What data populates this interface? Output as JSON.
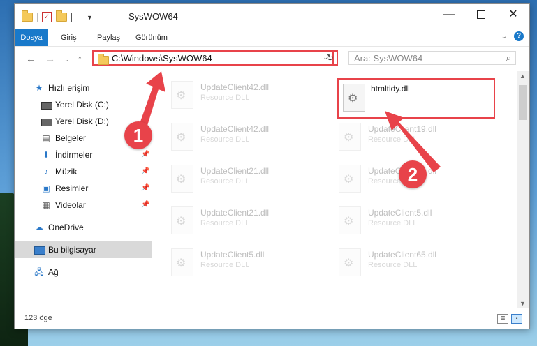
{
  "window": {
    "title": "SysWOW64"
  },
  "ribbon": {
    "tabs": [
      "Dosya",
      "Giriş",
      "Paylaş",
      "Görünüm"
    ],
    "active": "Dosya"
  },
  "address": {
    "path": "C:\\Windows\\SysWOW64"
  },
  "search": {
    "placeholder": "Ara: SysWOW64"
  },
  "sidebar": {
    "items": [
      {
        "label": "Hızlı erişim",
        "icon": "star-icon"
      },
      {
        "label": "Yerel Disk (C:)",
        "icon": "drive-icon"
      },
      {
        "label": "Yerel Disk (D:)",
        "icon": "drive-icon"
      },
      {
        "label": "Belgeler",
        "icon": "documents-icon"
      },
      {
        "label": "İndirmeler",
        "icon": "download-icon"
      },
      {
        "label": "Müzik",
        "icon": "music-icon"
      },
      {
        "label": "Resimler",
        "icon": "pictures-icon"
      },
      {
        "label": "Videolar",
        "icon": "videos-icon"
      },
      {
        "label": "OneDrive",
        "icon": "cloud-icon"
      },
      {
        "label": "Bu bilgisayar",
        "icon": "computer-icon"
      },
      {
        "label": "Ağ",
        "icon": "network-icon"
      }
    ],
    "selected": "Bu bilgisayar"
  },
  "files": [
    {
      "name": "UpdateClient42.dll",
      "desc": "Resource DLL"
    },
    {
      "name": "htmltidy.dll",
      "desc": ""
    },
    {
      "name": "UpdateClient42.dll",
      "desc": "Resource DLL"
    },
    {
      "name": "UpdateClient19.dll",
      "desc": "Resource DLL"
    },
    {
      "name": "UpdateClient21.dll",
      "desc": "Resource DLL"
    },
    {
      "name": "UpdateClient19.dll",
      "desc": "Resource DLL"
    },
    {
      "name": "UpdateClient21.dll",
      "desc": "Resource DLL"
    },
    {
      "name": "UpdateClient5.dll",
      "desc": "Resource DLL"
    },
    {
      "name": "UpdateClient5.dll",
      "desc": "Resource DLL"
    },
    {
      "name": "UpdateClient65.dll",
      "desc": "Resource DLL"
    }
  ],
  "status": {
    "count": "123 öge"
  },
  "annotations": {
    "step1": "1",
    "step2": "2"
  },
  "colors": {
    "accent": "#1979ca",
    "highlight": "#e8434a"
  }
}
